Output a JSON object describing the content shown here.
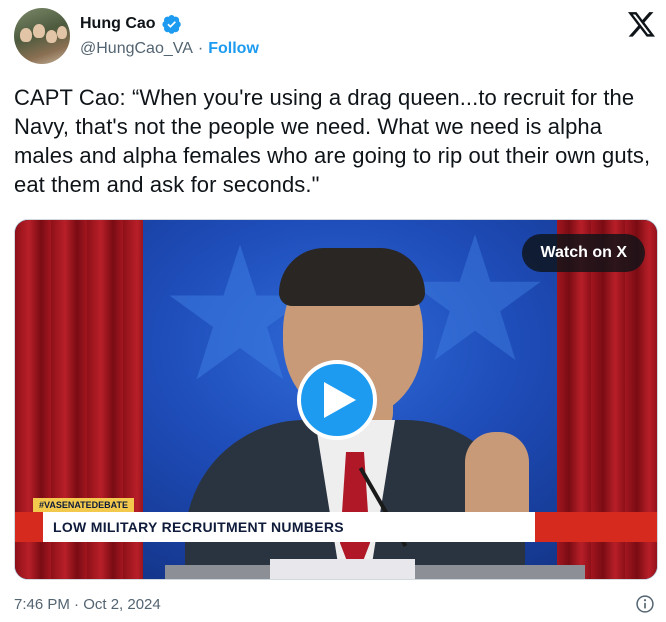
{
  "author": {
    "name": "Hung Cao",
    "handle": "@HungCao_VA",
    "separator": "·",
    "follow_label": "Follow",
    "verified": true
  },
  "platform_icon": "x-logo-icon",
  "tweet": {
    "text": "CAPT Cao: “When you're using a drag queen...to recruit for the Navy, that's not the people we need. What we need is alpha males and alpha females who are going to rip out their own guts, eat them and ask for seconds.\""
  },
  "video": {
    "watch_label": "Watch on X",
    "hashtag": "#VASENATEDEBATE",
    "banner": "LOW MILITARY RECRUITMENT NUMBERS",
    "play_icon": "play-icon"
  },
  "footer": {
    "timestamp": "7:46 PM · Oct 2, 2024",
    "info_icon": "info-icon"
  },
  "colors": {
    "accent": "#1d9bf0",
    "text": "#0f1419",
    "muted": "#536471"
  }
}
